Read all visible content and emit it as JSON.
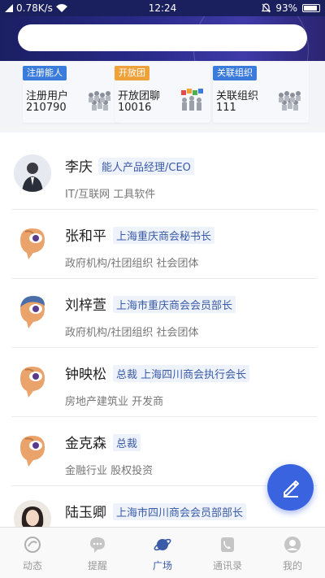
{
  "status_bar": {
    "network_speed": "0.78K/s",
    "time": "12:24",
    "battery": "93%"
  },
  "search": {
    "placeholder": ""
  },
  "stats": [
    {
      "tag": "注册能人",
      "tag_color": "#3a7bdc",
      "label": "注册用户",
      "value": "210790",
      "figure": "people-group-icon"
    },
    {
      "tag": "开放团",
      "tag_color": "#f0a23a",
      "label": "开放团聊",
      "value": "10016",
      "figure": "team-icon"
    },
    {
      "tag": "关联组织",
      "tag_color": "#3a7bdc",
      "label": "关联组织",
      "value": "111",
      "figure": "people-group-icon"
    }
  ],
  "people": [
    {
      "name": "李庆",
      "titles": "能人产品经理/CEO",
      "industry": "IT/互联网 工具软件",
      "avatar": "photo-man"
    },
    {
      "name": "张和平",
      "titles": "上海重庆商会秘书长",
      "industry": "政府机构/社团组织 社会团体",
      "avatar": "cartoon-brown"
    },
    {
      "name": "刘梓萱",
      "titles": "上海市重庆商会会员部长",
      "industry": "政府机构/社团组织 社会团体",
      "avatar": "cartoon-blue"
    },
    {
      "name": "钟映松",
      "titles": "总裁 上海四川商会执行会长",
      "industry": "房地产建筑业 开发商",
      "avatar": "cartoon-brown"
    },
    {
      "name": "金克森",
      "titles": "总裁",
      "industry": "金融行业 股权投资",
      "avatar": "cartoon-brown"
    },
    {
      "name": "陆玉卿",
      "titles": "上海市四川商会会员部部长",
      "industry": "",
      "avatar": "photo-woman"
    }
  ],
  "tabs": [
    {
      "label": "动态",
      "icon": "dynamic-icon",
      "active": false
    },
    {
      "label": "提醒",
      "icon": "chat-bubble-icon",
      "active": false
    },
    {
      "label": "广场",
      "icon": "planet-icon",
      "active": true
    },
    {
      "label": "通讯录",
      "icon": "contacts-icon",
      "active": false
    },
    {
      "label": "我的",
      "icon": "profile-icon",
      "active": false
    }
  ],
  "colors": {
    "accent": "#3a63e0",
    "header": "#1b1f63",
    "title_text": "#3a5ba8"
  }
}
